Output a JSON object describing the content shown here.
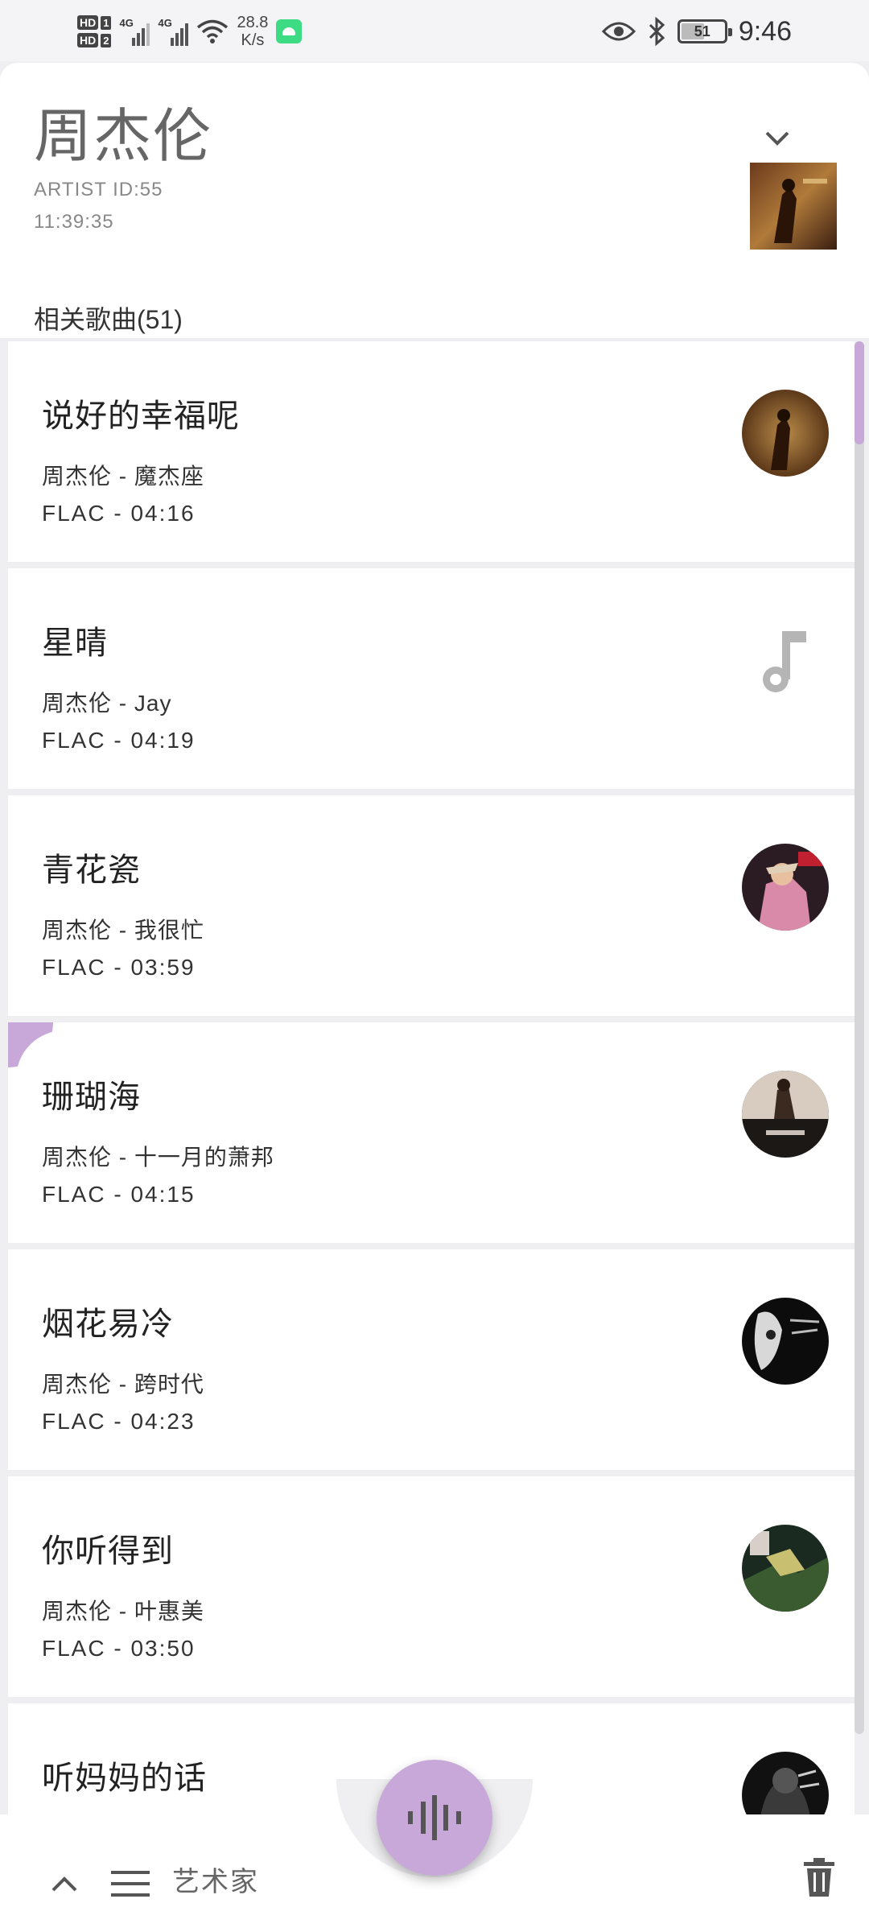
{
  "status_bar": {
    "net_speed_value": "28.8",
    "net_speed_unit": "K/s",
    "battery": "51",
    "time": "9:46"
  },
  "artist": {
    "name": "周杰伦",
    "id_text": "ARTIST ID:55",
    "timestamp": "11:39:35"
  },
  "section_title": "相关歌曲(51)",
  "songs": [
    {
      "title": "说好的幸福呢",
      "meta": "周杰伦 - 魔杰座",
      "format": "FLAC - 04:16"
    },
    {
      "title": "星晴",
      "meta": "周杰伦 - Jay",
      "format": "FLAC - 04:19"
    },
    {
      "title": "青花瓷",
      "meta": "周杰伦 - 我很忙",
      "format": "FLAC - 03:59"
    },
    {
      "title": "珊瑚海",
      "meta": "周杰伦 - 十一月的萧邦",
      "format": "FLAC - 04:15"
    },
    {
      "title": "烟花易冷",
      "meta": "周杰伦 - 跨时代",
      "format": "FLAC - 04:23"
    },
    {
      "title": "你听得到",
      "meta": "周杰伦 - 叶惠美",
      "format": "FLAC - 03:50"
    },
    {
      "title": "听妈妈的话"
    }
  ],
  "bottom_bar": {
    "label": "艺术家"
  },
  "colors": {
    "accent": "#c8a8d8",
    "background": "#efeff1",
    "card": "#ffffff"
  },
  "icons": [
    "eye-icon",
    "bluetooth-icon",
    "wifi-icon",
    "chevron-down-icon",
    "music-note-icon",
    "chevron-up-icon",
    "menu-icon",
    "trash-icon",
    "waveform-icon"
  ]
}
